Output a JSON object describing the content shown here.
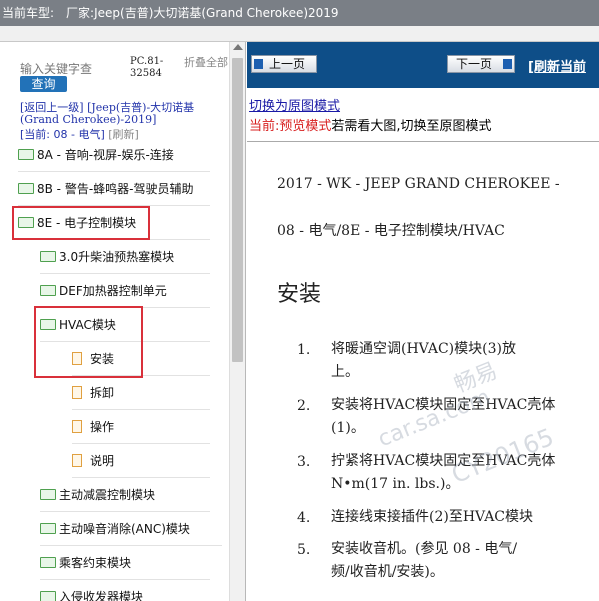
{
  "window": {
    "title_prefix": "当前车型:",
    "title_model": "厂家:Jeep(吉普)大切诺基(Grand Cherokee)2019"
  },
  "sidebar": {
    "search_placeholder": "输入关键字查",
    "search_button": "查询",
    "pc_code": "PC.81-32584",
    "collapse_all": "折叠全部",
    "back_link": "[返回上一级]",
    "breadcrumb_model": "[Jeep(吉普)-大切诺基(Grand Cherokee)-2019]",
    "current_label": "[当前:",
    "current_value": "08 - 电气]",
    "refresh_label": "[刷新]",
    "tree": [
      {
        "label": "8A - 音响-视屏-娱乐-连接",
        "type": "folder"
      },
      {
        "label": "8B - 警告-蜂鸣器-驾驶员辅助",
        "type": "folder"
      },
      {
        "label": "8E - 电子控制模块",
        "type": "folder"
      },
      {
        "label": "3.0升柴油预热塞模块",
        "type": "folder"
      },
      {
        "label": "DEF加热器控制单元",
        "type": "folder"
      },
      {
        "label": "HVAC模块",
        "type": "folder"
      },
      {
        "label": "安装",
        "type": "file"
      },
      {
        "label": "拆卸",
        "type": "file"
      },
      {
        "label": "操作",
        "type": "file"
      },
      {
        "label": "说明",
        "type": "file"
      },
      {
        "label": "主动减震控制模块",
        "type": "folder"
      },
      {
        "label": "主动噪音消除(ANC)模块",
        "type": "folder"
      },
      {
        "label": "乘客约束模块",
        "type": "folder"
      },
      {
        "label": "入侵收发器模块",
        "type": "folder"
      }
    ]
  },
  "content": {
    "prev_button": "上一页",
    "next_button": "下一页",
    "refresh_link": "[刷新当前",
    "mode_link": "切换为原图模式",
    "mode_note_prefix": "当前:",
    "mode_note_mode": "预览模式",
    "mode_note_suffix": "若需看大图,切换至原图模式",
    "doc_header_1": "2017 - WK - JEEP GRAND CHEROKEE -",
    "doc_header_2": "08 - 电气/8E - 电子控制模块/HVAC",
    "section_title": "安装",
    "steps": [
      {
        "num": "1.",
        "line1": "将暖通空调(HVAC)模块(3)放",
        "line2": "上。"
      },
      {
        "num": "2.",
        "line1": "安装将HVAC模块固定至HVAC壳体",
        "line2": "(1)。"
      },
      {
        "num": "3.",
        "line1": "拧紧将HVAC模块固定至HVAC壳体",
        "line2": "N•m(17 in. lbs.)。"
      },
      {
        "num": "4.",
        "line1": "连接线束接插件(2)至HVAC模块",
        "line2": ""
      },
      {
        "num": "5.",
        "line1": "安装收音机。(参见 08 - 电气/",
        "line2": "频/收音机/安装)。"
      }
    ],
    "watermark_1": "畅易",
    "watermark_2": "car.sa.com",
    "watermark_3": "CY20165"
  },
  "colors": {
    "nav_blue": "#0e4e88",
    "highlight_red": "#d9303a",
    "link_blue": "#1a1aa6",
    "note_red": "#d82020"
  }
}
